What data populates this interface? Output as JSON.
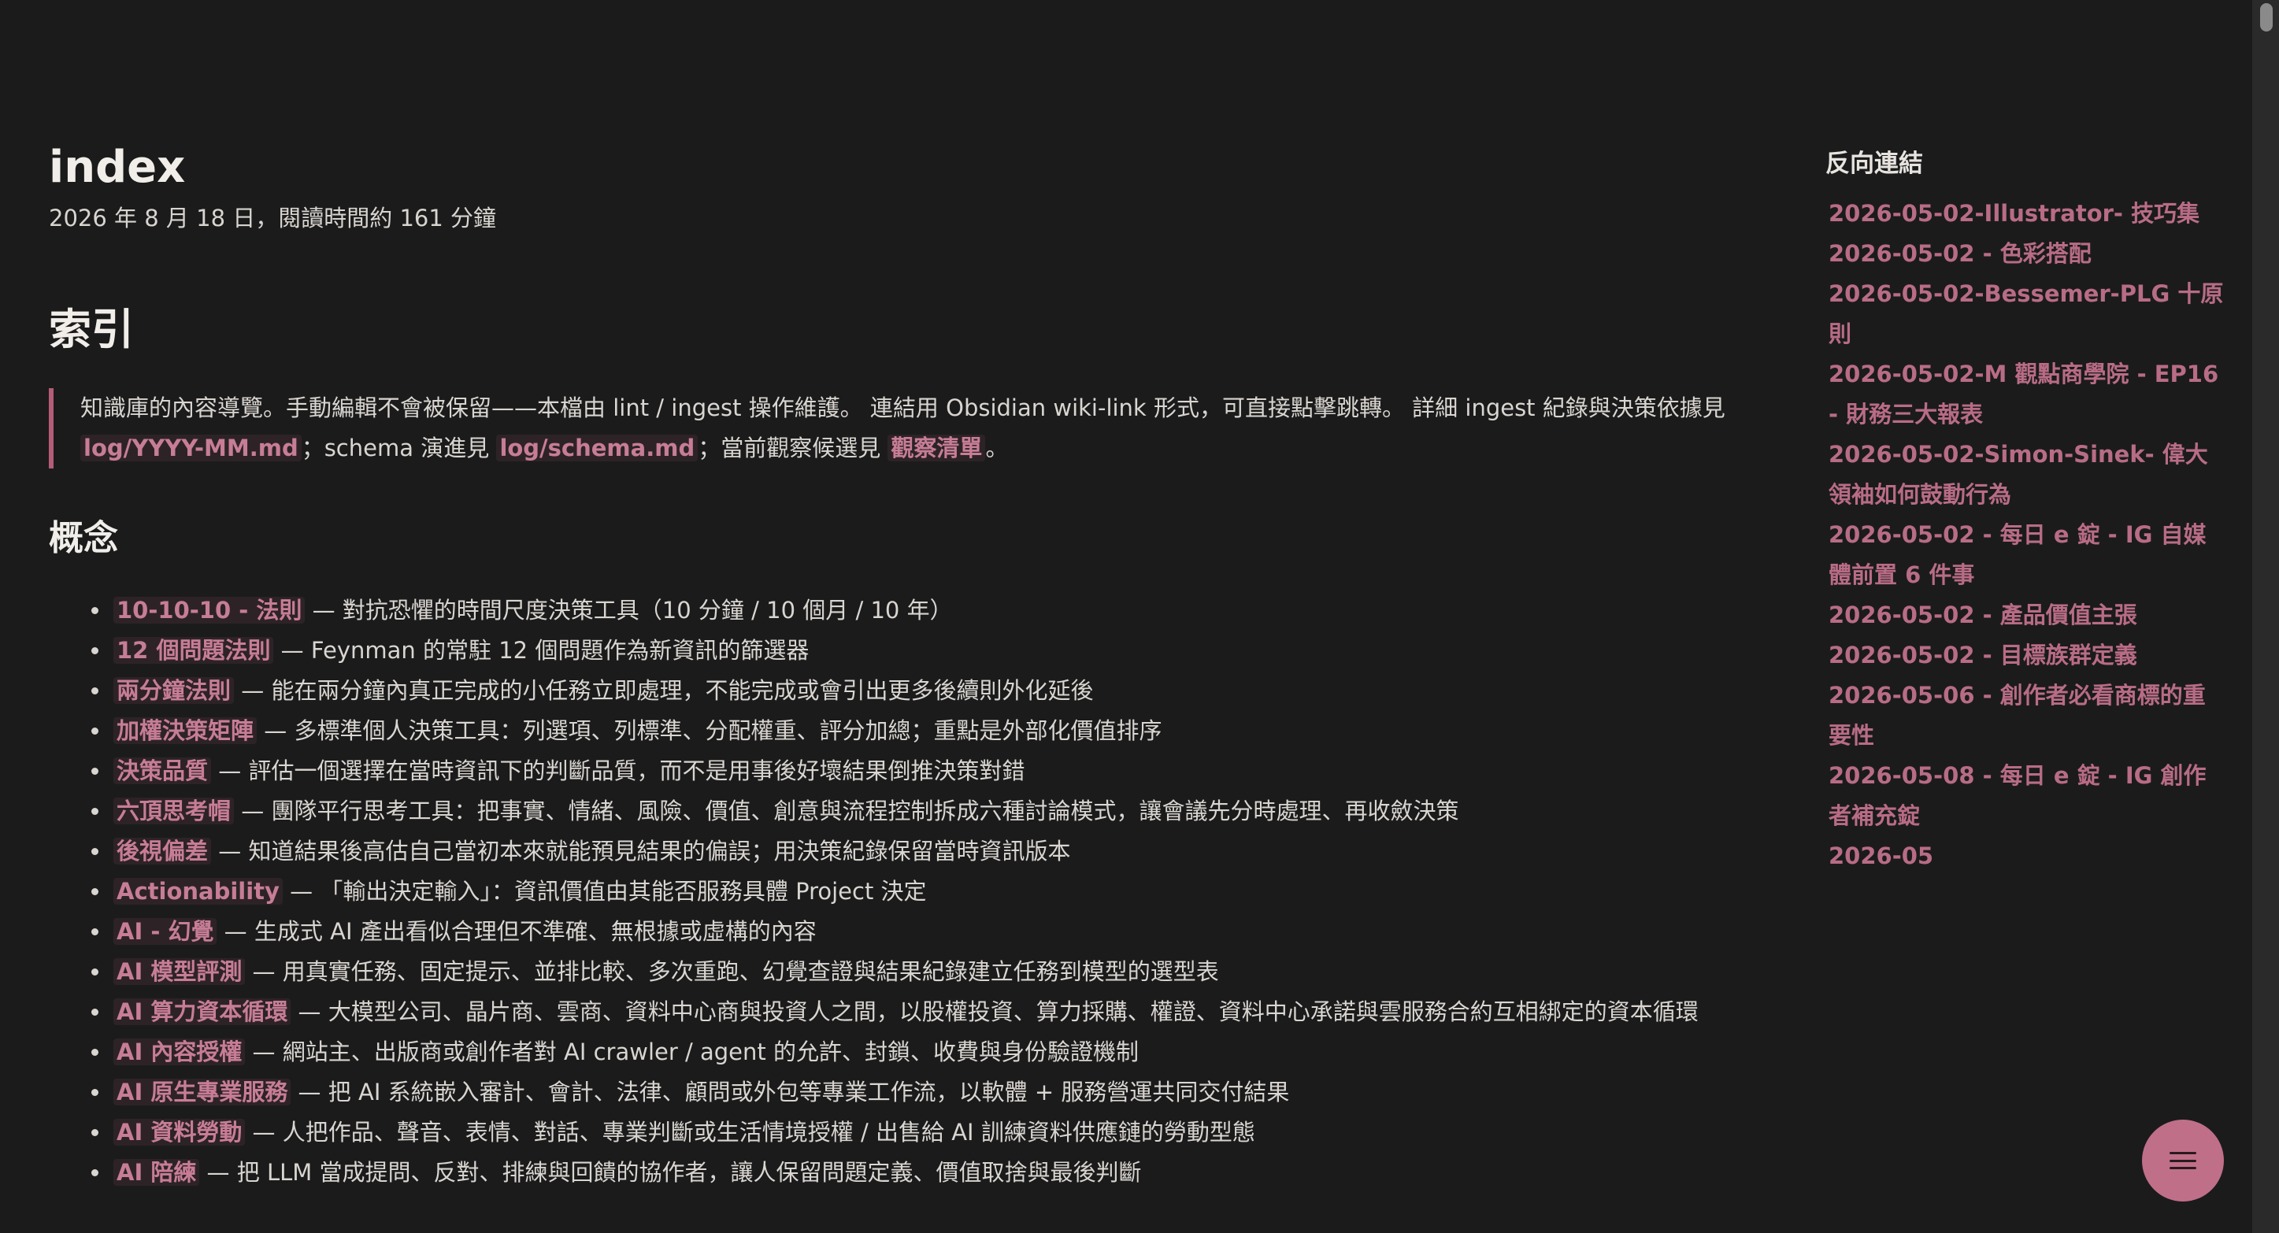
{
  "page": {
    "title": "index",
    "meta": "2026 年 8 月 18 日，閱讀時間約 161 分鐘"
  },
  "content": {
    "heading": "索引",
    "intro": {
      "text1": "知識庫的內容導覽。手動編輯不會被保留——本檔由 lint / ingest 操作維護。 連結用 Obsidian wiki-link 形式，可直接點擊跳轉。 詳細 ingest 紀錄與決策依據見 ",
      "link1": "log/YYYY-MM.md",
      "text2": "；schema 演進見 ",
      "link2": "log/schema.md",
      "text3": "；當前觀察候選見 ",
      "link3": "觀察清單",
      "text4": "。"
    },
    "concepts_heading": "概念",
    "concepts": [
      {
        "link": "10-10-10 - 法則",
        "desc": " — 對抗恐懼的時間尺度決策工具（10 分鐘 / 10 個月 / 10 年）"
      },
      {
        "link": "12 個問題法則",
        "desc": " — Feynman 的常駐 12 個問題作為新資訊的篩選器"
      },
      {
        "link": "兩分鐘法則",
        "desc": " — 能在兩分鐘內真正完成的小任務立即處理，不能完成或會引出更多後續則外化延後"
      },
      {
        "link": "加權決策矩陣",
        "desc": " — 多標準個人決策工具：列選項、列標準、分配權重、評分加總；重點是外部化價值排序"
      },
      {
        "link": "決策品質",
        "desc": " — 評估一個選擇在當時資訊下的判斷品質，而不是用事後好壞結果倒推決策對錯"
      },
      {
        "link": "六頂思考帽",
        "desc": " — 團隊平行思考工具：把事實、情緒、風險、價值、創意與流程控制拆成六種討論模式，讓會議先分時處理、再收斂決策"
      },
      {
        "link": "後視偏差",
        "desc": " — 知道結果後高估自己當初本來就能預見結果的偏誤；用決策紀錄保留當時資訊版本"
      },
      {
        "link": "Actionability",
        "desc": " — 「輸出決定輸入」：資訊價值由其能否服務具體 Project 決定"
      },
      {
        "link": "AI - 幻覺",
        "desc": " — 生成式 AI 產出看似合理但不準確、無根據或虛構的內容"
      },
      {
        "link": "AI 模型評測",
        "desc": " — 用真實任務、固定提示、並排比較、多次重跑、幻覺查證與結果紀錄建立任務到模型的選型表"
      },
      {
        "link": "AI 算力資本循環",
        "desc": " — 大模型公司、晶片商、雲商、資料中心商與投資人之間，以股權投資、算力採購、權證、資料中心承諾與雲服務合約互相綁定的資本循環"
      },
      {
        "link": "AI 內容授權",
        "desc": " — 網站主、出版商或創作者對 AI crawler / agent 的允許、封鎖、收費與身份驗證機制"
      },
      {
        "link": "AI 原生專業服務",
        "desc": " — 把 AI 系統嵌入審計、會計、法律、顧問或外包等專業工作流，以軟體 + 服務營運共同交付結果"
      },
      {
        "link": "AI 資料勞動",
        "desc": " — 人把作品、聲音、表情、對話、專業判斷或生活情境授權 / 出售給 AI 訓練資料供應鏈的勞動型態"
      },
      {
        "link": "AI 陪練",
        "desc": " — 把 LLM 當成提問、反對、排練與回饋的協作者，讓人保留問題定義、價值取捨與最後判斷"
      }
    ]
  },
  "sidebar": {
    "title": "反向連結",
    "links": [
      "2026-05-02-Illustrator- 技巧集",
      "2026-05-02 - 色彩搭配",
      "2026-05-02-Bessemer-PLG 十原則",
      "2026-05-02-M 觀點商學院 - EP16 - 財務三大報表",
      "2026-05-02-Simon-Sinek- 偉大領袖如何鼓動行為",
      "2026-05-02 - 每日 e 錠 - IG 自媒體前置 6 件事",
      "2026-05-02 - 產品價值主張",
      "2026-05-02 - 目標族群定義",
      "2026-05-06 - 創作者必看商標的重要性",
      "2026-05-08 - 每日 e 錠 - IG 創作者補充錠",
      "2026-05"
    ]
  },
  "fab": {
    "icon": "menu-icon"
  },
  "colors": {
    "background": "#1b1b1c",
    "accent": "#c77d96",
    "fab": "#c06f89"
  }
}
